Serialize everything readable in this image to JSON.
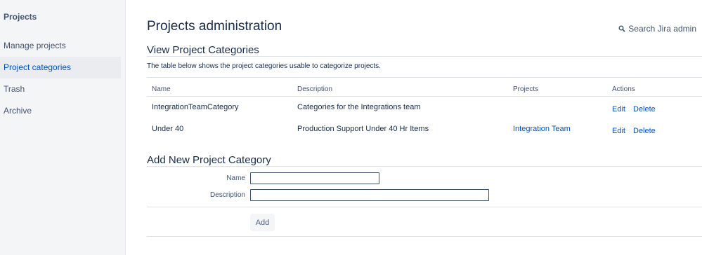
{
  "sidebar": {
    "title": "Projects",
    "items": [
      {
        "label": "Manage projects"
      },
      {
        "label": "Project categories"
      },
      {
        "label": "Trash"
      },
      {
        "label": "Archive"
      }
    ]
  },
  "header": {
    "title": "Projects administration",
    "search_label": "Search Jira admin"
  },
  "categories": {
    "heading": "View Project Categories",
    "intro": "The table below shows the project categories usable to categorize projects.",
    "columns": [
      "Name",
      "Description",
      "Projects",
      "Actions"
    ],
    "rows": [
      {
        "name": "IntegrationTeamCategory",
        "description": "Categories for the Integrations team",
        "projects": "",
        "edit": "Edit",
        "delete": "Delete"
      },
      {
        "name": "Under 40",
        "description": "Production Support Under 40 Hr Items",
        "projects": "Integration Team",
        "edit": "Edit",
        "delete": "Delete"
      }
    ]
  },
  "add_form": {
    "heading": "Add New Project Category",
    "name_label": "Name",
    "name_value": "",
    "description_label": "Description",
    "description_value": "",
    "submit_label": "Add"
  },
  "colors": {
    "link": "#0052cc",
    "sidebar_bg": "#f4f5f7",
    "active_bg": "#ebecf0",
    "text": "#172b4d"
  }
}
